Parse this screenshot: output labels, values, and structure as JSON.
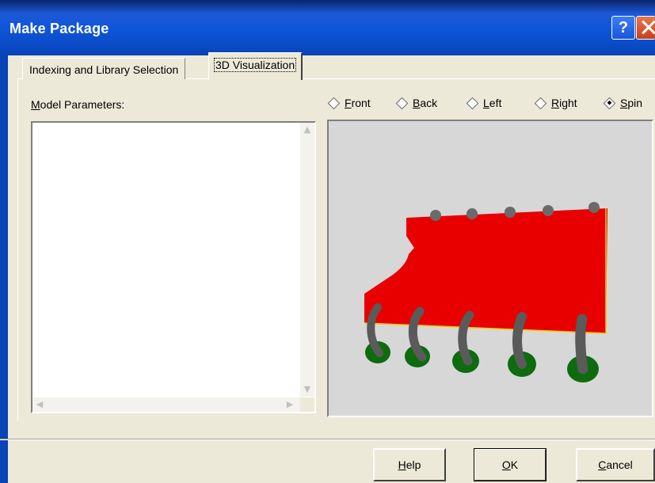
{
  "window": {
    "title": "Make Package"
  },
  "tabs": [
    {
      "label": "Indexing and Library Selection",
      "active": false
    },
    {
      "label": "3D Visualization",
      "active": true
    }
  ],
  "model_parameters": {
    "label": "Model Parameters:"
  },
  "view_options": [
    {
      "label": "Front",
      "mnemonic": "F",
      "selected": false
    },
    {
      "label": "Back",
      "mnemonic": "B",
      "selected": false
    },
    {
      "label": "Left",
      "mnemonic": "L",
      "selected": false
    },
    {
      "label": "Right",
      "mnemonic": "R",
      "selected": false
    },
    {
      "label": "Spin",
      "mnemonic": "S",
      "selected": true
    }
  ],
  "buttons": {
    "help": "Help",
    "ok": "OK",
    "cancel": "Cancel"
  },
  "colors": {
    "title_bar": "#0E55D8",
    "body": "#RED",
    "package_body": "#E00000",
    "pins": "#5A5A5A",
    "pads": "#0E6B0E",
    "viewport_bg": "#D7D7D7"
  }
}
